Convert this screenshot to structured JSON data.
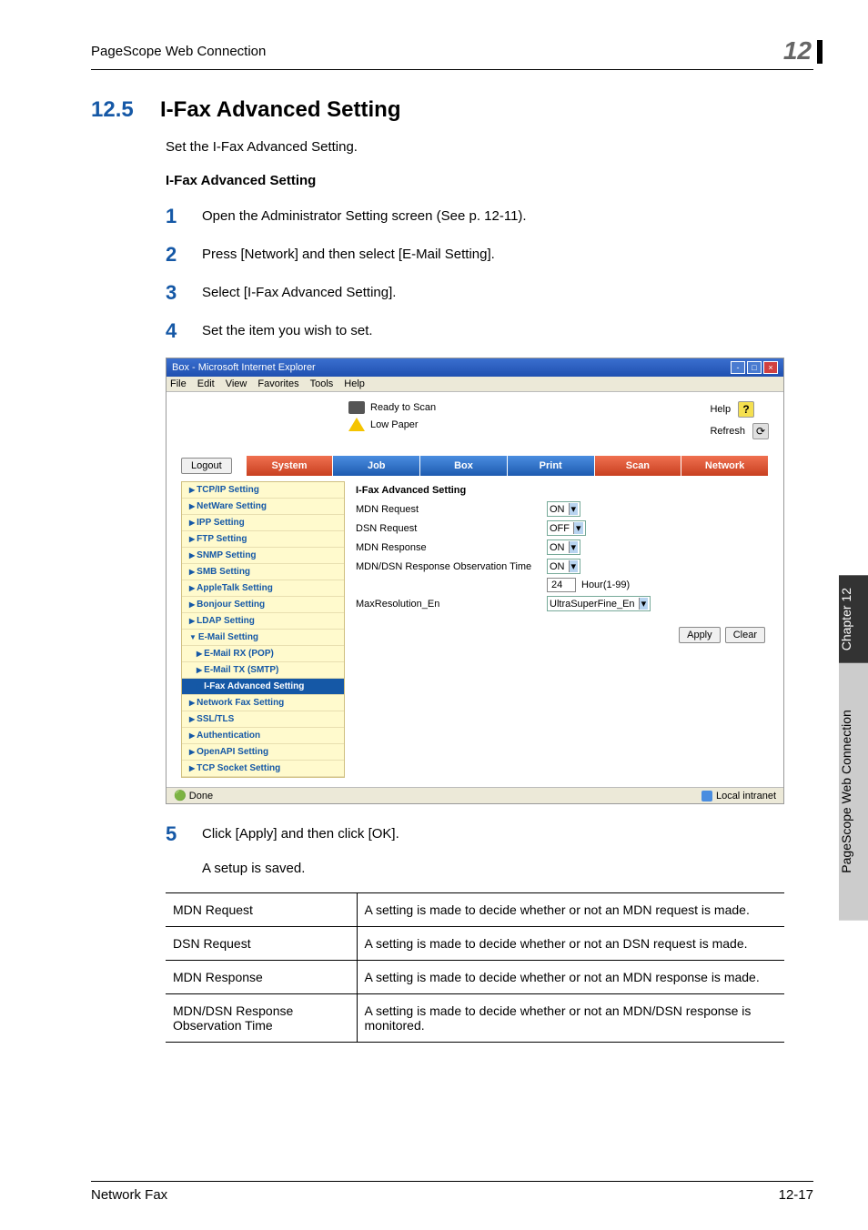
{
  "header": {
    "left": "PageScope Web Connection",
    "right": "12"
  },
  "section": {
    "number": "12.5",
    "title": "I-Fax Advanced Setting",
    "intro": "Set the I-Fax Advanced Setting.",
    "sub": "I-Fax Advanced Setting"
  },
  "steps": [
    {
      "n": "1",
      "t": "Open the Administrator Setting screen (See p. 12-11)."
    },
    {
      "n": "2",
      "t": "Press [Network] and then select [E-Mail Setting]."
    },
    {
      "n": "3",
      "t": "Select [I-Fax Advanced Setting]."
    },
    {
      "n": "4",
      "t": "Set the item you wish to set."
    }
  ],
  "screenshot": {
    "window_title": "Box - Microsoft Internet Explorer",
    "menubar": [
      "File",
      "Edit",
      "View",
      "Favorites",
      "Tools",
      "Help"
    ],
    "status": [
      {
        "label": "Ready to Scan"
      },
      {
        "label": "Low Paper"
      }
    ],
    "topright": {
      "help_label": "Help",
      "help_badge": "?",
      "refresh_label": "Refresh",
      "refresh_badge": "⟳"
    },
    "logout": "Logout",
    "tabs": [
      {
        "label": "System",
        "red": true
      },
      {
        "label": "Job",
        "red": false
      },
      {
        "label": "Box",
        "red": false
      },
      {
        "label": "Print",
        "red": false
      },
      {
        "label": "Scan",
        "red": true
      },
      {
        "label": "Network",
        "red": true
      }
    ],
    "sidebar": [
      {
        "label": "TCP/IP Setting"
      },
      {
        "label": "NetWare Setting"
      },
      {
        "label": "IPP Setting"
      },
      {
        "label": "FTP Setting"
      },
      {
        "label": "SNMP Setting"
      },
      {
        "label": "SMB Setting"
      },
      {
        "label": "AppleTalk Setting"
      },
      {
        "label": "Bonjour Setting"
      },
      {
        "label": "LDAP Setting"
      },
      {
        "label": "E-Mail Setting",
        "open": true
      },
      {
        "label": "E-Mail RX (POP)",
        "sub": true
      },
      {
        "label": "E-Mail TX (SMTP)",
        "sub": true
      },
      {
        "label": "I-Fax Advanced Setting",
        "sub": true,
        "active": true
      },
      {
        "label": "Network Fax Setting"
      },
      {
        "label": "SSL/TLS"
      },
      {
        "label": "Authentication"
      },
      {
        "label": "OpenAPI Setting"
      },
      {
        "label": "TCP Socket Setting"
      }
    ],
    "content": {
      "title": "I-Fax Advanced Setting",
      "rows": [
        {
          "label": "MDN Request",
          "type": "select",
          "value": "ON"
        },
        {
          "label": "DSN Request",
          "type": "select",
          "value": "OFF"
        },
        {
          "label": "MDN Response",
          "type": "select",
          "value": "ON"
        },
        {
          "label": "MDN/DSN Response Observation Time",
          "type": "select",
          "value": "ON"
        },
        {
          "label": "",
          "type": "input",
          "value": "24",
          "suffix": "Hour(1-99)"
        },
        {
          "label": "MaxResolution_En",
          "type": "select",
          "value": "UltraSuperFine_En"
        }
      ],
      "buttons": {
        "apply": "Apply",
        "clear": "Clear"
      }
    },
    "statusbar": {
      "done": "Done",
      "zone": "Local intranet"
    }
  },
  "step5": {
    "n": "5",
    "t": "Click [Apply] and then click [OK]."
  },
  "after": "A setup is saved.",
  "table": [
    {
      "k": "MDN Request",
      "v": "A setting is made to decide whether or not an MDN request is made."
    },
    {
      "k": "DSN Request",
      "v": "A setting is made to decide whether or not an DSN request is made."
    },
    {
      "k": "MDN Response",
      "v": "A setting is made to decide whether or not an MDN response is made."
    },
    {
      "k": "MDN/DSN Response Observation Time",
      "v": "A setting is made to decide whether or not an MDN/DSN response is monitored."
    }
  ],
  "side_tab": {
    "dark": "Chapter 12",
    "light": "PageScope Web Connection"
  },
  "footer": {
    "left": "Network Fax",
    "right": "12-17"
  }
}
